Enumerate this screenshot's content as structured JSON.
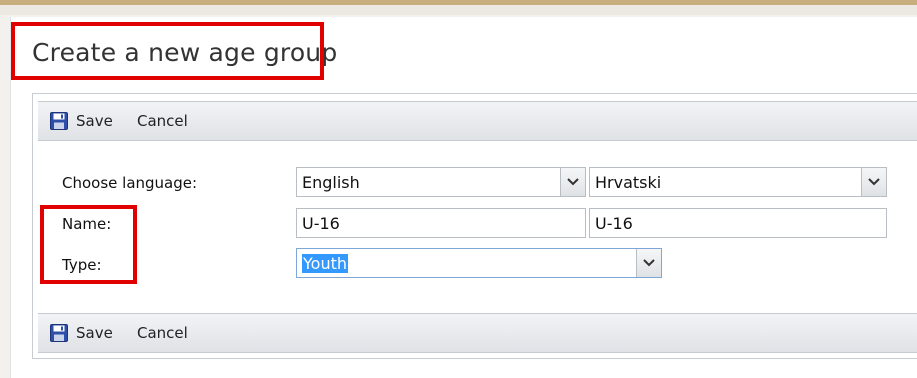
{
  "page": {
    "title": "Create a new age group"
  },
  "toolbar_top": {
    "save_label": "Save",
    "cancel_label": "Cancel"
  },
  "toolbar_bottom": {
    "save_label": "Save",
    "cancel_label": "Cancel"
  },
  "form": {
    "language_label": "Choose language:",
    "name_label": "Name:",
    "type_label": "Type:",
    "language_primary": "English",
    "language_secondary": "Hrvatski",
    "name_primary": "U-16",
    "name_secondary": "U-16",
    "type_value": "Youth"
  },
  "colors": {
    "highlight_red": "#e00000",
    "selection_blue": "#3399ff",
    "accent_strip": "#c8ad7d"
  },
  "icons": {
    "save": "floppy-disk-icon",
    "dropdown": "chevron-down-icon"
  }
}
